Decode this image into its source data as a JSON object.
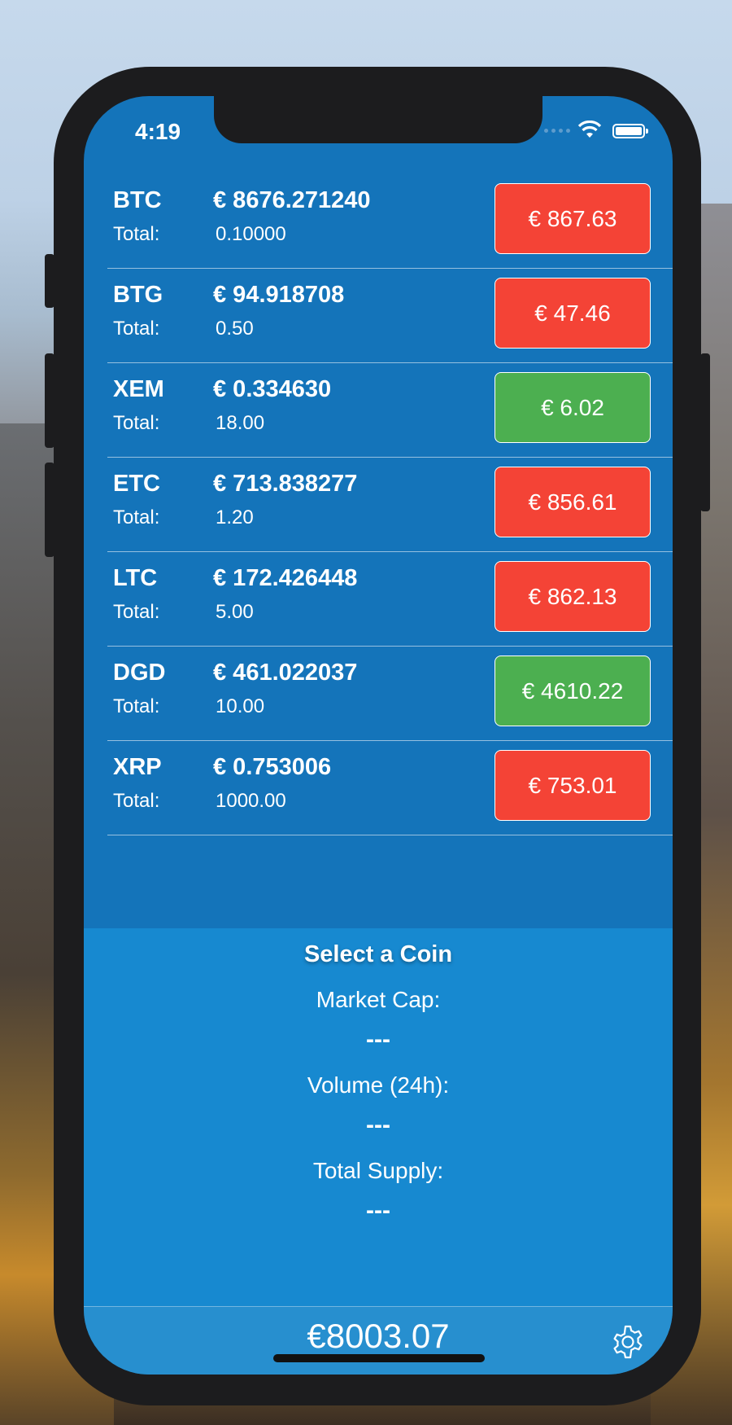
{
  "status_bar": {
    "time": "4:19"
  },
  "coins": [
    {
      "symbol": "BTC",
      "price": "€ 8676.271240",
      "total_label": "Total:",
      "total": "0.10000",
      "value": "€ 867.63",
      "color": "#f44336"
    },
    {
      "symbol": "BTG",
      "price": "€ 94.918708",
      "total_label": "Total:",
      "total": "0.50",
      "value": "€ 47.46",
      "color": "#f44336"
    },
    {
      "symbol": "XEM",
      "price": "€ 0.334630",
      "total_label": "Total:",
      "total": "18.00",
      "value": "€ 6.02",
      "color": "#4caf50"
    },
    {
      "symbol": "ETC",
      "price": "€ 713.838277",
      "total_label": "Total:",
      "total": "1.20",
      "value": "€ 856.61",
      "color": "#f44336"
    },
    {
      "symbol": "LTC",
      "price": "€ 172.426448",
      "total_label": "Total:",
      "total": "5.00",
      "value": "€ 862.13",
      "color": "#f44336"
    },
    {
      "symbol": "DGD",
      "price": "€ 461.022037",
      "total_label": "Total:",
      "total": "10.00",
      "value": "€ 4610.22",
      "color": "#4caf50"
    },
    {
      "symbol": "XRP",
      "price": "€ 0.753006",
      "total_label": "Total:",
      "total": "1000.00",
      "value": "€ 753.01",
      "color": "#f44336"
    }
  ],
  "details": {
    "title": "Select a Coin",
    "market_cap_label": "Market Cap:",
    "market_cap_value": "---",
    "volume_label": "Volume (24h):",
    "volume_value": "---",
    "supply_label": "Total Supply:",
    "supply_value": "---"
  },
  "footer": {
    "portfolio_total": "€8003.07",
    "settings_icon": "gear-icon"
  },
  "colors": {
    "background": "#1474ba",
    "panel": "#1789d0",
    "loss": "#f44336",
    "gain": "#4caf50"
  }
}
